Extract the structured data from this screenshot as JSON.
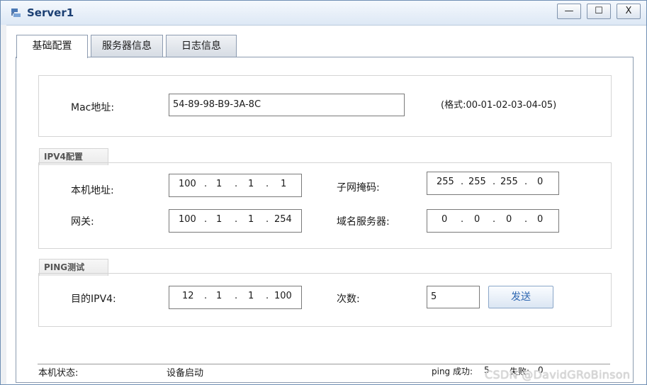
{
  "window": {
    "title": "Server1",
    "minimize_label": "—",
    "maximize_label": "☐",
    "close_label": "X"
  },
  "tabs": [
    {
      "label": "基础配置",
      "active": true
    },
    {
      "label": "服务器信息",
      "active": false
    },
    {
      "label": "日志信息",
      "active": false
    }
  ],
  "mac": {
    "label": "Mac地址:",
    "value": "54-89-98-B9-3A-8C",
    "hint": "(格式:00-01-02-03-04-05)"
  },
  "ipv4": {
    "group_label": "IPV4配置",
    "local_label": "本机地址:",
    "local": [
      "100",
      "1",
      "1",
      "1"
    ],
    "mask_label": "子网掩码:",
    "mask": [
      "255",
      "255",
      "255",
      "0"
    ],
    "gateway_label": "网关:",
    "gateway": [
      "100",
      "1",
      "1",
      "254"
    ],
    "dns_label": "域名服务器:",
    "dns": [
      "0",
      "0",
      "0",
      "0"
    ]
  },
  "ping": {
    "group_label": "PING测试",
    "dest_label": "目的IPV4:",
    "dest": [
      "12",
      "1",
      "1",
      "100"
    ],
    "count_label": "次数:",
    "count": "5",
    "send_label": "发送"
  },
  "status": {
    "state_label": "本机状态:",
    "state_value": "设备启动",
    "success_label": "ping 成功:",
    "success_value": "5",
    "fail_label": "失败:",
    "fail_value": "0"
  },
  "watermark": "CSDN @DavidGRoBinson",
  "dot": "."
}
